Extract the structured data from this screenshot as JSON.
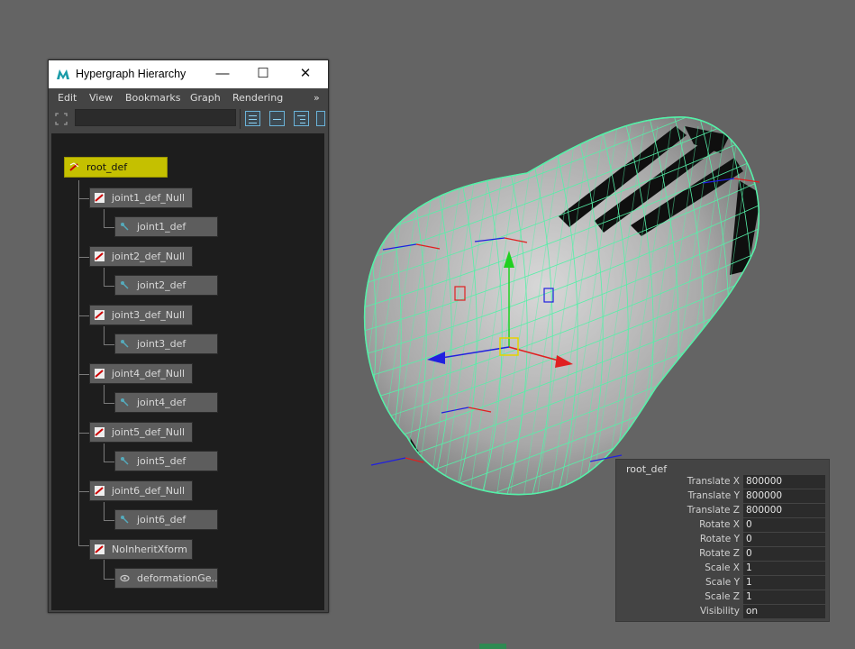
{
  "window": {
    "title": "Hypergraph Hierarchy",
    "min_glyph": "—",
    "max_glyph": "☐",
    "close_glyph": "✕"
  },
  "menu": {
    "edit": "Edit",
    "view": "View",
    "bookmarks": "Bookmarks",
    "graph": "Graph",
    "rendering": "Rendering",
    "overflow": "»"
  },
  "nodes": {
    "root": "root_def",
    "j1_null": "joint1_def_Null",
    "j1": "joint1_def",
    "j2_null": "joint2_def_Null",
    "j2": "joint2_def",
    "j3_null": "joint3_def_Null",
    "j3": "joint3_def",
    "j4_null": "joint4_def_Null",
    "j4": "joint4_def",
    "j5_null": "joint5_def_Null",
    "j5": "joint5_def",
    "j6_null": "joint6_def_Null",
    "j6": "joint6_def",
    "noinherit": "NoInheritXform",
    "deform": "deformationGe..."
  },
  "channel_box": {
    "object": "root_def",
    "rows": [
      {
        "label": "Translate X",
        "value": "800000"
      },
      {
        "label": "Translate Y",
        "value": "800000"
      },
      {
        "label": "Translate Z",
        "value": "800000"
      },
      {
        "label": "Rotate X",
        "value": "0"
      },
      {
        "label": "Rotate Y",
        "value": "0"
      },
      {
        "label": "Rotate Z",
        "value": "0"
      },
      {
        "label": "Scale X",
        "value": "1"
      },
      {
        "label": "Scale Y",
        "value": "1"
      },
      {
        "label": "Scale Z",
        "value": "1"
      },
      {
        "label": "Visibility",
        "value": "on"
      }
    ]
  },
  "colors": {
    "wireframe": "#55f0a8",
    "selected_node": "#c5c000",
    "viewport_bg": "#646464",
    "axis_x": "#e02020",
    "axis_y": "#20d020",
    "axis_z": "#2020e0"
  },
  "icons": [
    "maya-logo-icon",
    "transform-node-icon",
    "joint-icon",
    "deformation-icon",
    "layout-icon",
    "collapse-icon",
    "expand-icon"
  ]
}
